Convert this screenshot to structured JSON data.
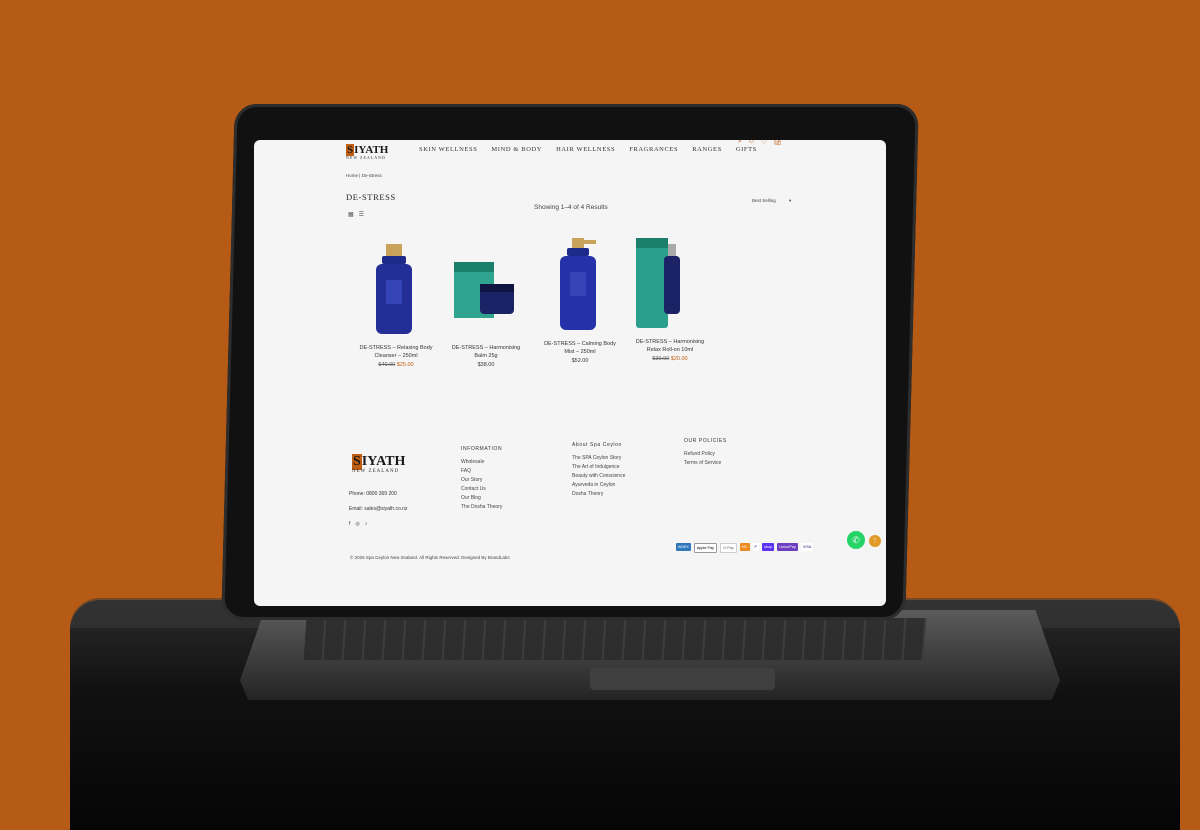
{
  "brand": {
    "logo_main": "IYATH",
    "logo_initial": "S",
    "logo_sub": "NEW ZEALAND"
  },
  "nav": {
    "items": [
      "SKIN WELLNESS",
      "MIND & BODY",
      "HAIR WELLNESS",
      "FRAGRANCES",
      "RANGES",
      "GIFTS"
    ],
    "cart_count": "0"
  },
  "breadcrumb": {
    "home": "Home",
    "separator": "|",
    "current": "De-Stress"
  },
  "page": {
    "title": "DE-STRESS",
    "results": "Showing 1–4 of 4 Results",
    "sort_label": "Best Selling"
  },
  "products": [
    {
      "name_line1": "DE-STRESS – Relaxing Body",
      "name_line2": "Cleanser – 250ml",
      "old_price": "$40.00",
      "price": "$25.00"
    },
    {
      "name_line1": "DE-STRESS – Harmonising",
      "name_line2": "Balm 25g",
      "old_price": "",
      "price": "$38.00"
    },
    {
      "name_line1": "DE-STRESS – Calming Body",
      "name_line2": "Mist – 250ml",
      "old_price": "",
      "price": "$52.00"
    },
    {
      "name_line1": "DE-STRESS – Harmonising",
      "name_line2": "Relax Roll-on 10ml",
      "old_price": "$30.00",
      "price": "$20.00"
    }
  ],
  "footer": {
    "phone": "Phone: 0800 369 200",
    "email": "Email: sales@siyath.co.nz",
    "information": {
      "title": "INFORMATION",
      "links": [
        "Wholesale",
        "FAQ",
        "Our Story",
        "Contact Us",
        "Our Blog",
        "The Dosha Theory"
      ]
    },
    "about": {
      "title": "About Spa Ceylon",
      "links": [
        "The SPA Ceylon Story",
        "The Art of Indulgence",
        "Beauty with Conscience",
        "Ayurveda in Ceylon",
        "Dosha Theory"
      ]
    },
    "our_policies": {
      "title": "OUR POLICIES",
      "links": [
        "Refund Policy",
        "Terms of Service"
      ]
    },
    "copyright": "© 2025 Spa Ceylon New Zealand. All Rights Reserved. Designed By BrandLabs",
    "payments": [
      "AMEX",
      "Apple Pay",
      "G Pay",
      "MC",
      "P",
      "shop",
      "UnionPay",
      "VISA"
    ]
  },
  "colors": {
    "background": "#b65b15",
    "accent": "#c25e12",
    "screen": "#f5f5f5",
    "whatsapp": "#25d366"
  }
}
